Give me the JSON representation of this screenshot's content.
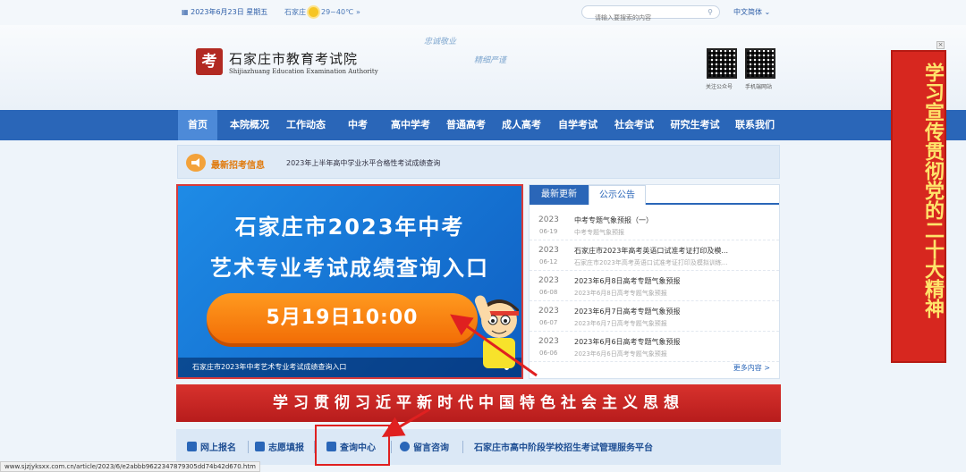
{
  "topbar": {
    "date": "▦ 2023年6月23日 星期五",
    "city": "石家庄",
    "temp": "29~40℃",
    "weather_more": "»",
    "search_placeholder": "请输入要搜索的内容",
    "lang": "中文简体"
  },
  "header": {
    "seal_text": "考",
    "site_name": "石家庄市教育考试院",
    "site_en": "Shijiazhuang Education Examination Authority",
    "slogan1": "忠诚敬业",
    "slogan2": "精细严谨",
    "qr1_label": "关注公众号",
    "qr2_label": "手机端网站"
  },
  "nav": {
    "items": [
      "首页",
      "本院概况",
      "工作动态",
      "中考",
      "高中学考",
      "普通高考",
      "成人高考",
      "自学考试",
      "社会考试",
      "研究生考试",
      "联系我们"
    ]
  },
  "ticker": {
    "label": "最新招考信息",
    "text": "2023年上半年高中学业水平合格性考试成绩查询"
  },
  "poster": {
    "line1": "石家庄市2023年中考",
    "line2": "艺术专业考试成绩查询入口",
    "pill": "5月19日10:00",
    "caption": "石家庄市2023年中考艺术专业考试成绩查询入口"
  },
  "news": {
    "tab_latest": "最新更新",
    "tab_notice": "公示公告",
    "rows": [
      {
        "year": "2023",
        "md": "06-19",
        "title": "中考专题气象预报（一）",
        "sub": "中考专题气象预报"
      },
      {
        "year": "2023",
        "md": "06-12",
        "title": "石家庄市2023年高考英语口试准考证打印及模...",
        "sub": "石家庄市2023年高考英语口试准考证打印及模拟训练..."
      },
      {
        "year": "2023",
        "md": "06-08",
        "title": "2023年6月8日高考专题气象预报",
        "sub": "2023年6月8日高考专题气象预报"
      },
      {
        "year": "2023",
        "md": "06-07",
        "title": "2023年6月7日高考专题气象预报",
        "sub": "2023年6月7日高考专题气象预报"
      },
      {
        "year": "2023",
        "md": "06-06",
        "title": "2023年6月6日高考专题气象预报",
        "sub": "2023年6月6日高考专题气象预报"
      }
    ],
    "more": "更多内容 >"
  },
  "red_strip": "学习贯彻习近平新时代中国特色社会主义思想",
  "services": {
    "online_apply": "网上报名",
    "volunteer": "志愿填报",
    "query_center": "查询中心",
    "message": "留言咨询",
    "platform": "石家庄市高中阶段学校招生考试管理服务平台"
  },
  "side_banner": "学习宣传贯彻党的二十大精神",
  "close_label": "×",
  "status_url": "www.sjzjyksxx.com.cn/article/2023/6/e2abbb9622347879305dd74b42d670.htm",
  "colors": {
    "nav_blue": "#2a66b8",
    "accent_red": "#d7271f",
    "pill_orange": "#f26d06"
  }
}
